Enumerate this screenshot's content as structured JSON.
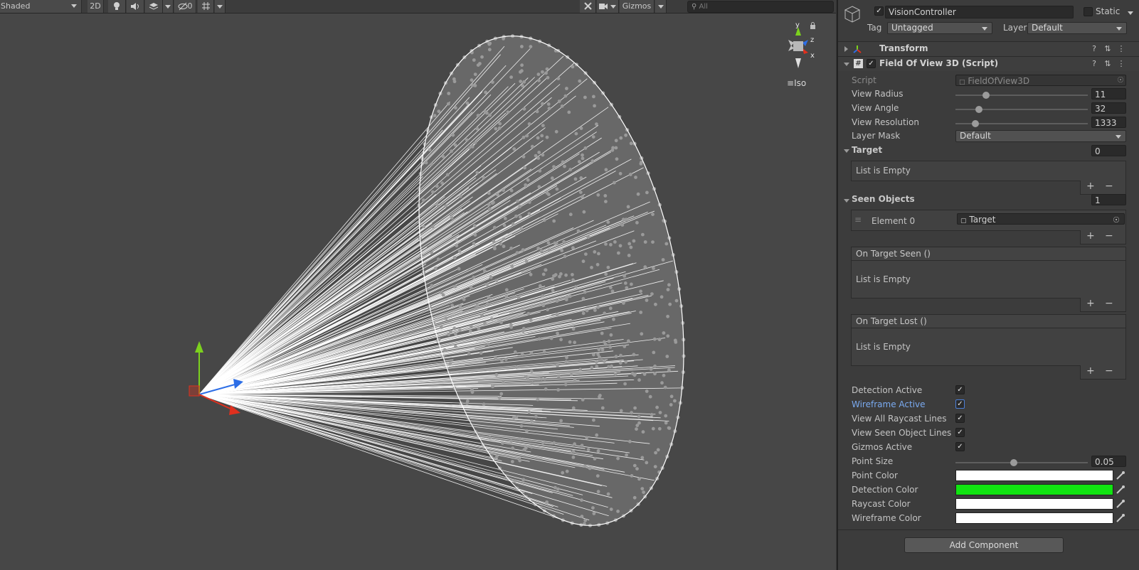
{
  "scene": {
    "toolbar": {
      "shading_mode": "Shaded",
      "mode_2d": "2D",
      "hidden_count": "0",
      "gizmos_label": "Gizmos",
      "search_placeholder": "All"
    },
    "orientation": {
      "y_label": "y",
      "z_label": "z",
      "x_label": "x",
      "projection_label": "Iso"
    },
    "colors": {
      "background": "#474747",
      "lines": "#ffffff",
      "points": "#9a9a9a"
    }
  },
  "inspector": {
    "object_name": "VisionController",
    "static_label": "Static",
    "tag_label": "Tag",
    "tag_value": "Untagged",
    "layer_label": "Layer",
    "layer_value": "Default",
    "transform": {
      "title": "Transform"
    },
    "script_component": {
      "title": "Field Of View 3D (Script)",
      "script_label": "Script",
      "script_value": "FieldOfView3D",
      "view_radius": {
        "label": "View Radius",
        "value": "11",
        "fraction": 0.23
      },
      "view_angle": {
        "label": "View Angle",
        "value": "32",
        "fraction": 0.18
      },
      "view_resolution": {
        "label": "View Resolution",
        "value": "1333",
        "fraction": 0.15
      },
      "layer_mask": {
        "label": "Layer Mask",
        "value": "Default"
      },
      "target": {
        "label": "Target",
        "count": "0",
        "empty_text": "List is Empty"
      },
      "seen_objects": {
        "label": "Seen Objects",
        "count": "1",
        "element_label": "Element 0",
        "element_value": "Target"
      },
      "on_target_seen": {
        "label": "On Target Seen ()",
        "empty_text": "List is Empty"
      },
      "on_target_lost": {
        "label": "On Target Lost ()",
        "empty_text": "List is Empty"
      },
      "toggles": [
        {
          "label": "Detection Active",
          "checked": true
        },
        {
          "label": "Wireframe Active",
          "checked": true
        },
        {
          "label": "View All Raycast Lines",
          "checked": true
        },
        {
          "label": "View Seen Object Lines",
          "checked": true
        },
        {
          "label": "Gizmos Active",
          "checked": true
        }
      ],
      "point_size": {
        "label": "Point Size",
        "value": "0.05",
        "fraction": 0.44
      },
      "colors": [
        {
          "label": "Point Color",
          "hex": "#ffffff"
        },
        {
          "label": "Detection Color",
          "hex": "#11e411"
        },
        {
          "label": "Raycast Color",
          "hex": "#ffffff"
        },
        {
          "label": "Wireframe Color",
          "hex": "#ffffff"
        }
      ]
    },
    "add_component_label": "Add Component"
  }
}
